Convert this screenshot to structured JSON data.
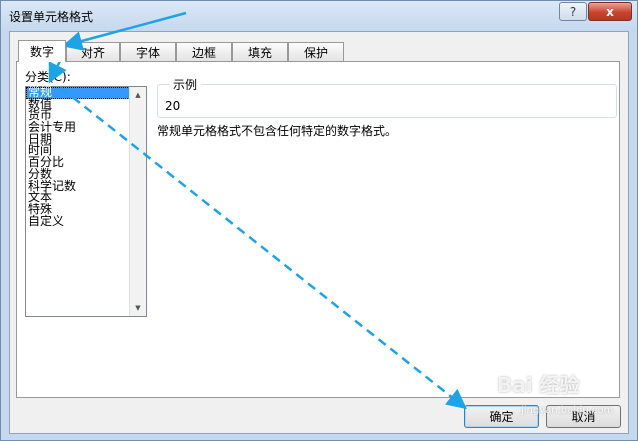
{
  "window": {
    "title": "设置单元格格式",
    "help_label": "?",
    "close_label": "x"
  },
  "tabs": [
    {
      "label": "数字"
    },
    {
      "label": "对齐"
    },
    {
      "label": "字体"
    },
    {
      "label": "边框"
    },
    {
      "label": "填充"
    },
    {
      "label": "保护"
    }
  ],
  "category": {
    "label": "分类(C):",
    "items": [
      "常规",
      "数值",
      "货币",
      "会计专用",
      "日期",
      "时间",
      "百分比",
      "分数",
      "科学记数",
      "文本",
      "特殊",
      "自定义"
    ],
    "selected": "常规"
  },
  "sample": {
    "legend": "示例",
    "value": "20"
  },
  "description": "常规单元格格式不包含任何特定的数字格式。",
  "buttons": {
    "ok": "确定",
    "cancel": "取消"
  },
  "watermark": {
    "logo": "Bai 经验",
    "url": "jingyan.baidu.com"
  },
  "annotation_color": "#1ea3e6"
}
